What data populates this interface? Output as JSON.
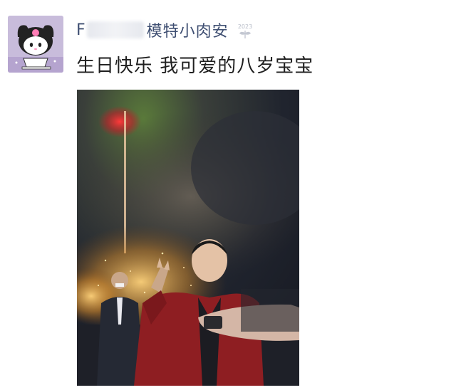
{
  "post": {
    "author_initial": "F",
    "author_name": "模特小肉安",
    "badge_year": "2023",
    "text": "生日快乐 我可爱的八岁宝宝"
  },
  "colors": {
    "author_name": "#3f4f72",
    "post_text": "#1f1f1f",
    "background": "#ffffff"
  },
  "icons": {
    "avatar": "kuromi-avatar-icon",
    "badge": "year-badge-icon"
  }
}
